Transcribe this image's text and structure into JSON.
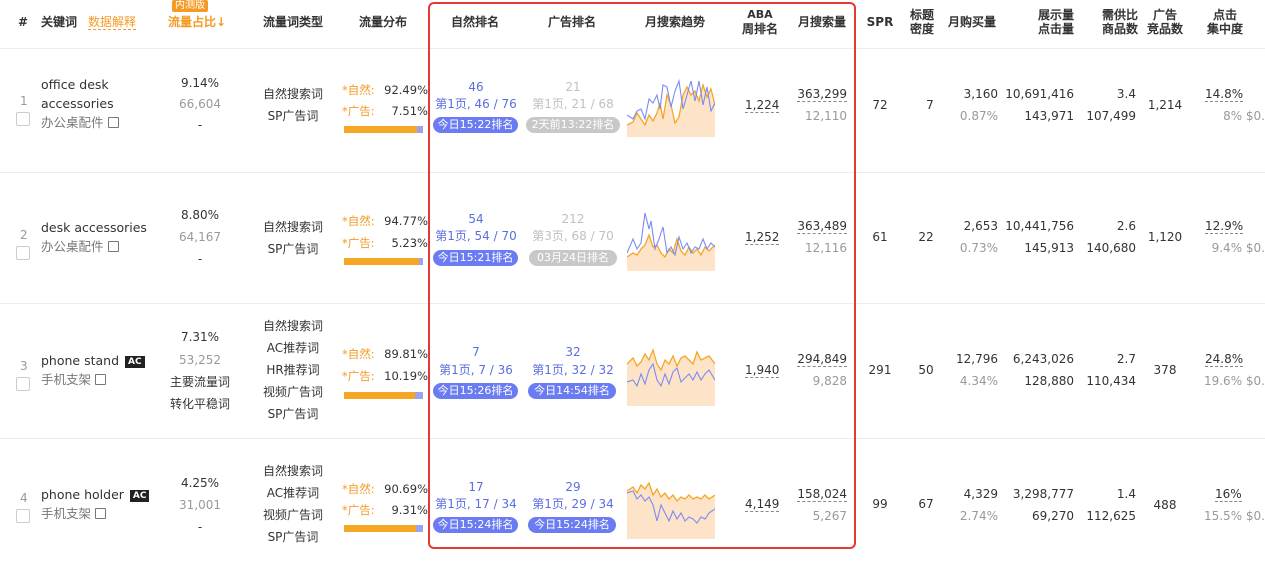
{
  "header": {
    "index": "#",
    "keyword": "关键词",
    "data_explain": "数据解释",
    "beta_badge": "内测版",
    "traffic_share": "流量占比↓",
    "traffic_type": "流量词类型",
    "traffic_dist": "流量分布",
    "organic_rank": "自然排名",
    "ad_rank": "广告排名",
    "monthly_trend": "月搜索趋势",
    "aba_1": "ABA",
    "aba_2": "周排名",
    "monthly_search": "月搜索量",
    "spr": "SPR",
    "title_density_1": "标题",
    "title_density_2": "密度",
    "monthly_purchase": "月购买量",
    "impressions_1": "展示量",
    "impressions_2": "点击量",
    "supply_demand_1": "需供比",
    "supply_demand_2": "商品数",
    "ad_competitors_1": "广告",
    "ad_competitors_2": "竞品数",
    "click_conc_1": "点击",
    "click_conc_2": "集中度"
  },
  "labels": {
    "organic_prefix": "*自然:",
    "ad_prefix": "*广告:"
  },
  "rows": [
    {
      "index": "1",
      "keyword_line1": "office desk",
      "keyword_line2": "accessories",
      "cn": "办公桌配件",
      "ac": "",
      "share": "9.14%",
      "share_count": "66,604",
      "share_extra": "-",
      "types": [
        "自然搜索词",
        "SP广告词"
      ],
      "organic_pct": "92.49%",
      "ad_pct": "7.51%",
      "organic_fraction": 0.9249,
      "org_rank_top": "46",
      "org_rank_page": "第1页, 46 / 76",
      "org_rank_pill": "今日15:22排名",
      "org_pill_style": "blue",
      "ad_rank_top": "21",
      "ad_rank_page": "第1页, 21 / 68",
      "ad_rank_pill": "2天前13:22排名",
      "ad_pill_style": "gray",
      "ad_rank_style": "lgray",
      "aba": "1,224",
      "search": "363,299",
      "search_sub": "12,110",
      "spr": "72",
      "density": "7",
      "purchase": "3,160",
      "purchase_pct": "0.87%",
      "impressions": "10,691,416",
      "clicks": "143,971",
      "ratio": "3.4",
      "products": "107,499",
      "ad_comp": "1,214",
      "click_conc": "14.8%",
      "click_conc_sub": "8% $0."
    },
    {
      "index": "2",
      "keyword_line1": "desk accessories",
      "keyword_line2": "",
      "cn": "办公桌配件",
      "ac": "",
      "share": "8.80%",
      "share_count": "64,167",
      "share_extra": "-",
      "types": [
        "自然搜索词",
        "SP广告词"
      ],
      "organic_pct": "94.77%",
      "ad_pct": "5.23%",
      "organic_fraction": 0.9477,
      "org_rank_top": "54",
      "org_rank_page": "第1页, 54 / 70",
      "org_rank_pill": "今日15:21排名",
      "org_pill_style": "blue",
      "ad_rank_top": "212",
      "ad_rank_page": "第3页, 68 / 70",
      "ad_rank_pill": "03月24日排名",
      "ad_pill_style": "gray",
      "ad_rank_style": "lgray",
      "aba": "1,252",
      "search": "363,489",
      "search_sub": "12,116",
      "spr": "61",
      "density": "22",
      "purchase": "2,653",
      "purchase_pct": "0.73%",
      "impressions": "10,441,756",
      "clicks": "145,913",
      "ratio": "2.6",
      "products": "140,680",
      "ad_comp": "1,120",
      "click_conc": "12.9%",
      "click_conc_sub": "9.4% $0."
    },
    {
      "index": "3",
      "keyword_line1": "phone stand",
      "keyword_line2": "",
      "cn": "手机支架",
      "ac": "AC",
      "share": "7.31%",
      "share_count": "53,252",
      "share_extra": "主要流量词",
      "share_extra2": "转化平稳词",
      "types": [
        "自然搜索词",
        "AC推荐词",
        "HR推荐词",
        "视频广告词",
        "SP广告词"
      ],
      "organic_pct": "89.81%",
      "ad_pct": "10.19%",
      "organic_fraction": 0.8981,
      "org_rank_top": "7",
      "org_rank_page": "第1页, 7 / 36",
      "org_rank_pill": "今日15:26排名",
      "org_pill_style": "blue",
      "ad_rank_top": "32",
      "ad_rank_page": "第1页, 32 / 32",
      "ad_rank_pill": "今日14:54排名",
      "ad_pill_style": "blue",
      "ad_rank_style": "blue",
      "aba": "1,940",
      "search": "294,849",
      "search_sub": "9,828",
      "spr": "291",
      "density": "50",
      "purchase": "12,796",
      "purchase_pct": "4.34%",
      "impressions": "6,243,026",
      "clicks": "128,880",
      "ratio": "2.7",
      "products": "110,434",
      "ad_comp": "378",
      "click_conc": "24.8%",
      "click_conc_sub": "19.6% $0."
    },
    {
      "index": "4",
      "keyword_line1": "phone holder",
      "keyword_line2": "",
      "cn": "手机支架",
      "ac": "AC",
      "share": "4.25%",
      "share_count": "31,001",
      "share_extra": "-",
      "types": [
        "自然搜索词",
        "AC推荐词",
        "视频广告词",
        "SP广告词"
      ],
      "organic_pct": "90.69%",
      "ad_pct": "9.31%",
      "organic_fraction": 0.9069,
      "org_rank_top": "17",
      "org_rank_page": "第1页, 17 / 34",
      "org_rank_pill": "今日15:24排名",
      "org_pill_style": "blue",
      "ad_rank_top": "29",
      "ad_rank_page": "第1页, 29 / 34",
      "ad_rank_pill": "今日15:24排名",
      "ad_pill_style": "blue",
      "ad_rank_style": "blue",
      "aba": "4,149",
      "search": "158,024",
      "search_sub": "5,267",
      "spr": "99",
      "density": "67",
      "purchase": "4,329",
      "purchase_pct": "2.74%",
      "impressions": "3,298,777",
      "clicks": "69,270",
      "ratio": "1.4",
      "products": "112,625",
      "ad_comp": "488",
      "click_conc": "16%",
      "click_conc_sub": "15.5% $0."
    }
  ],
  "colors": {
    "accent": "#f59a23",
    "rank_blue": "#5b6ee1",
    "highlight_box": "#e53935",
    "trend_orange": "#f5a623",
    "trend_blue": "#7b8cf0"
  }
}
